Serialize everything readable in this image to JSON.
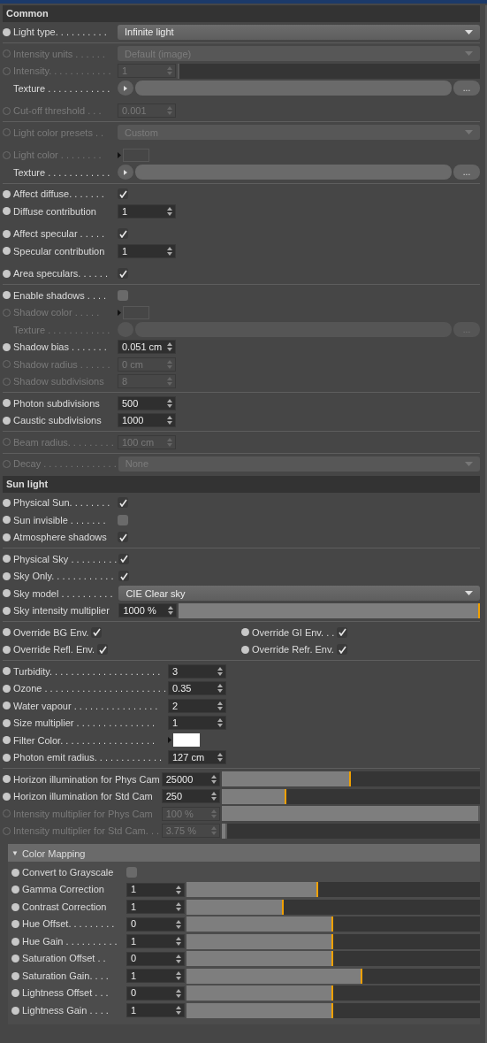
{
  "sections": [
    {
      "title": "Common",
      "kind": "plain",
      "groups": [
        {
          "rows": [
            {
              "kind": "dropdown",
              "label": "Light type. . . . . . . . . .",
              "value": "Infinite light",
              "disabled": false
            }
          ]
        },
        {
          "rows": [
            {
              "kind": "dropdown",
              "label": "Intensity units . . . . . .",
              "value": "Default (image)",
              "disabled": true
            },
            {
              "kind": "slider",
              "label": "Intensity. . . . . . . . . . . .",
              "value": "1",
              "level": 0.005,
              "disabled": true
            },
            {
              "kind": "texture",
              "label": "Texture . . . . . . . . . . . .",
              "browse": "...",
              "disabled": false
            },
            {
              "kind": "number",
              "label": "Cut-off threshold . . .",
              "value": "0.001",
              "disabled": true,
              "gap_before": true
            }
          ]
        },
        {
          "rows": [
            {
              "kind": "dropdown",
              "label": "Light color presets . .",
              "value": "Custom",
              "disabled": true
            },
            {
              "kind": "color",
              "label": "Light color . . . . . . . .",
              "disabled": true,
              "gap_before": true
            },
            {
              "kind": "texture",
              "label": "Texture . . . . . . . . . . . .",
              "browse": "...",
              "disabled": false
            }
          ]
        },
        {
          "rows": [
            {
              "kind": "checkbox",
              "label": "Affect diffuse. . . . . . .",
              "checked": true,
              "disabled": false
            },
            {
              "kind": "number",
              "label": "Diffuse contribution",
              "value": "1",
              "disabled": false
            },
            {
              "kind": "checkbox",
              "label": "Affect specular . . . . .",
              "checked": true,
              "disabled": false,
              "gap_before": true
            },
            {
              "kind": "number",
              "label": "Specular contribution",
              "value": "1",
              "disabled": false
            },
            {
              "kind": "checkbox",
              "label": "Area speculars. . . . . .",
              "checked": true,
              "disabled": false,
              "gap_before": true
            }
          ]
        },
        {
          "rows": [
            {
              "kind": "checkbox",
              "label": "Enable shadows . . . .",
              "checked": false,
              "disabled": false
            },
            {
              "kind": "color",
              "label": "Shadow color . . . . .",
              "disabled": true
            },
            {
              "kind": "texture",
              "label": "Texture . . . . . . . . . . . .",
              "browse": "...",
              "disabled": true
            },
            {
              "kind": "number",
              "label": "Shadow bias . . . . . . .",
              "value": "0.051 cm",
              "disabled": false
            },
            {
              "kind": "number",
              "label": "Shadow radius . . . . . .",
              "value": "0 cm",
              "disabled": true
            },
            {
              "kind": "number",
              "label": "Shadow subdivisions",
              "value": "8",
              "disabled": true
            }
          ]
        },
        {
          "rows": [
            {
              "kind": "number",
              "label": "Photon subdivisions",
              "value": "500",
              "disabled": false
            },
            {
              "kind": "number",
              "label": "Caustic subdivisions",
              "value": "1000",
              "disabled": false
            }
          ]
        },
        {
          "rows": [
            {
              "kind": "number",
              "label": "Beam radius. . . . . . . . .",
              "value": "100 cm",
              "disabled": true
            }
          ]
        },
        {
          "rows": [
            {
              "kind": "dropdown",
              "label": "Decay . . . . . . . . . . . . . .",
              "value": "None",
              "disabled": true
            }
          ]
        }
      ]
    },
    {
      "title": "Sun light",
      "kind": "plain",
      "groups": [
        {
          "rows": [
            {
              "kind": "checkbox",
              "label": "Physical Sun. . . . . . . .",
              "checked": true,
              "disabled": false
            },
            {
              "kind": "checkbox",
              "label": "Sun invisible . . . . . . .",
              "checked": false,
              "disabled": false
            },
            {
              "kind": "checkbox",
              "label": "Atmosphere shadows",
              "checked": true,
              "disabled": false
            }
          ]
        },
        {
          "rows": [
            {
              "kind": "checkbox",
              "label": "Physical Sky . . . . . . . . .",
              "checked": true,
              "disabled": false
            },
            {
              "kind": "checkbox",
              "label": "Sky Only. . . . . . . . . . . .",
              "checked": true,
              "disabled": false
            },
            {
              "kind": "dropdown",
              "label": "Sky model . . . . . . . . . .",
              "value": "CIE Clear sky",
              "disabled": false
            },
            {
              "kind": "slider",
              "label": "Sky intensity multiplier",
              "value": "1000 %",
              "level": 1,
              "disabled": false
            }
          ]
        },
        {
          "rows": [
            {
              "kind": "checkbox_pair",
              "items": [
                {
                  "label": "Override BG Env.",
                  "checked": true
                },
                {
                  "label": "Override GI Env. . .",
                  "checked": true
                }
              ]
            },
            {
              "kind": "checkbox_pair",
              "items": [
                {
                  "label": "Override Refl. Env.",
                  "checked": true
                },
                {
                  "label": "Override Refr. Env.",
                  "checked": true
                }
              ]
            }
          ]
        },
        {
          "rows": [
            {
              "kind": "number",
              "label": "Turbidity. . . . . . . . . . . . . . . . . . . . .",
              "value": "3",
              "disabled": false
            },
            {
              "kind": "number",
              "label": "Ozone . . . . . . . . . . . . . . . . . . . . . . .",
              "value": "0.35",
              "disabled": false
            },
            {
              "kind": "number",
              "label": "Water vapour . . . . . . . . . . . . . . . .",
              "value": "2",
              "disabled": false
            },
            {
              "kind": "number",
              "label": "Size multiplier . . . . . . . . . . . . . . .",
              "value": "1",
              "disabled": false
            },
            {
              "kind": "color",
              "label": "Filter Color. . . . . . . . . . . . . . . . . .",
              "color": "#ffffff",
              "disabled": false
            },
            {
              "kind": "number",
              "label": "Photon emit radius. . . . . . . . . . . . .",
              "value": "127 cm",
              "disabled": false
            }
          ]
        },
        {
          "rows": [
            {
              "kind": "slider",
              "label": "Horizon illumination for Phys Cam",
              "value": "25000",
              "level": 0.5,
              "disabled": false
            },
            {
              "kind": "slider",
              "label": "Horizon illumination for Std Cam",
              "value": "250",
              "level": 0.25,
              "disabled": false
            },
            {
              "kind": "slider",
              "label": "Intensity multiplier for Phys Cam",
              "value": "100 %",
              "level": 1,
              "disabled": true
            },
            {
              "kind": "slider",
              "label": "Intensity multiplier for Std Cam. . .",
              "value": "3.75 %",
              "level": 0.02,
              "disabled": true
            }
          ]
        }
      ]
    },
    {
      "title": "Color Mapping",
      "kind": "collapsible",
      "expanded": true,
      "toggle": "▼",
      "groups": [
        {
          "rows": [
            {
              "kind": "checkbox",
              "label": "Convert to Grayscale",
              "checked": false,
              "disabled": false
            },
            {
              "kind": "slider",
              "label": "Gamma Correction",
              "value": "1",
              "level": 0.45,
              "disabled": false
            },
            {
              "kind": "slider",
              "label": "Contrast Correction",
              "value": "1",
              "level": 0.33,
              "disabled": false
            },
            {
              "kind": "slider",
              "label": "Hue Offset. . . . . . . . .",
              "value": "0",
              "level": 0.5,
              "disabled": false
            },
            {
              "kind": "slider",
              "label": "Hue Gain . . . . . . . . . .",
              "value": "1",
              "level": 0.5,
              "disabled": false
            },
            {
              "kind": "slider",
              "label": "Saturation Offset . .",
              "value": "0",
              "level": 0.5,
              "disabled": false
            },
            {
              "kind": "slider",
              "label": "Saturation Gain. . . .",
              "value": "1",
              "level": 0.6,
              "disabled": false
            },
            {
              "kind": "slider",
              "label": "Lightness Offset . . .",
              "value": "0",
              "level": 0.5,
              "disabled": false
            },
            {
              "kind": "slider",
              "label": "Lightness Gain . . . .",
              "value": "1",
              "level": 0.5,
              "disabled": false
            }
          ]
        }
      ]
    }
  ]
}
